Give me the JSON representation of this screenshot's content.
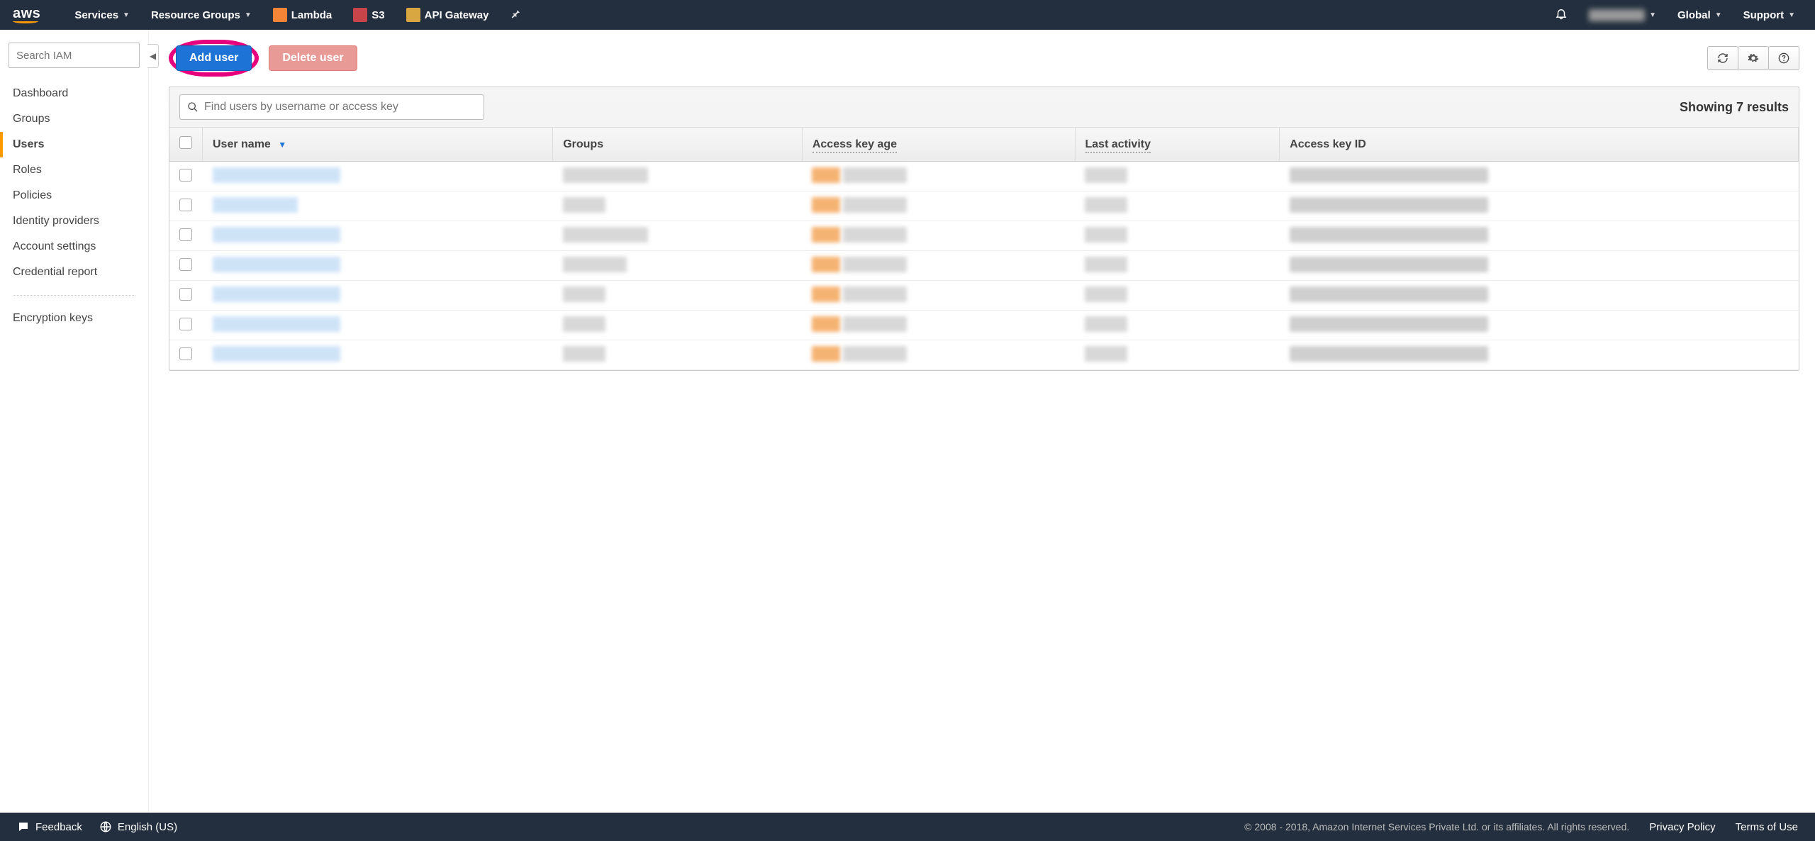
{
  "topnav": {
    "logo_text": "aws",
    "services_label": "Services",
    "resource_groups_label": "Resource Groups",
    "pinned_services": [
      {
        "label": "Lambda"
      },
      {
        "label": "S3"
      },
      {
        "label": "API Gateway"
      }
    ],
    "region_label": "Global",
    "support_label": "Support"
  },
  "sidebar": {
    "search_placeholder": "Search IAM",
    "items": [
      {
        "label": "Dashboard"
      },
      {
        "label": "Groups"
      },
      {
        "label": "Users",
        "active": true
      },
      {
        "label": "Roles"
      },
      {
        "label": "Policies"
      },
      {
        "label": "Identity providers"
      },
      {
        "label": "Account settings"
      },
      {
        "label": "Credential report"
      }
    ],
    "extra_items": [
      {
        "label": "Encryption keys"
      }
    ]
  },
  "actions": {
    "add_user_label": "Add user",
    "delete_user_label": "Delete user"
  },
  "panel": {
    "find_placeholder": "Find users by username or access key",
    "results_text": "Showing 7 results",
    "columns": {
      "username": "User name",
      "groups": "Groups",
      "access_key_age": "Access key age",
      "last_activity": "Last activity",
      "access_key_id": "Access key ID"
    },
    "row_count": 7
  },
  "footer": {
    "feedback_label": "Feedback",
    "language_label": "English (US)",
    "copyright": "© 2008 - 2018, Amazon Internet Services Private Ltd. or its affiliates. All rights reserved.",
    "privacy_label": "Privacy Policy",
    "terms_label": "Terms of Use"
  }
}
